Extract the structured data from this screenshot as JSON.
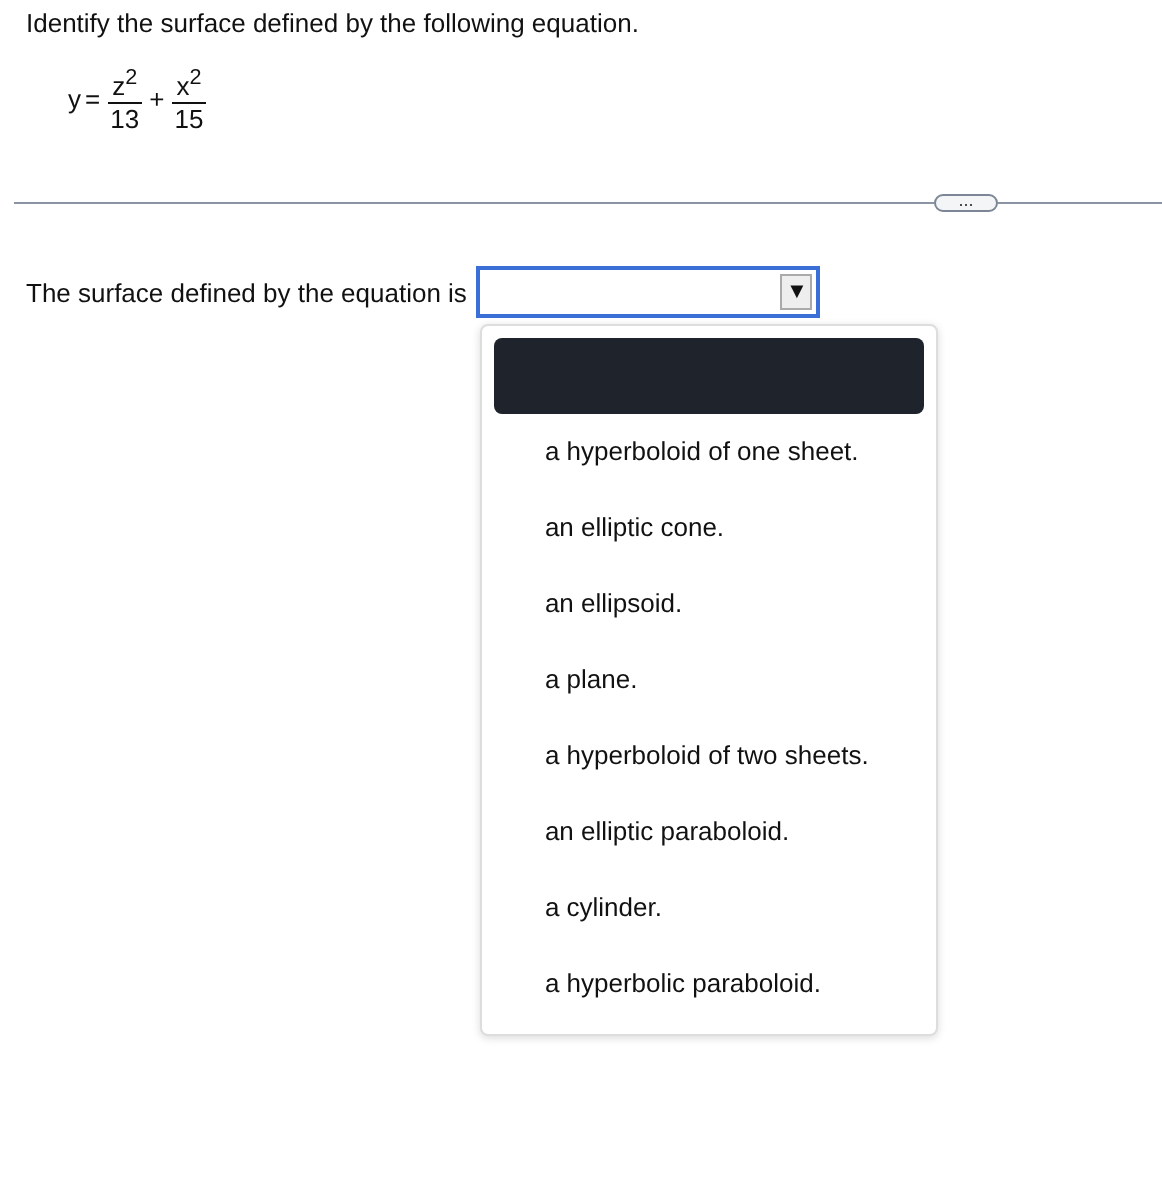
{
  "question": "Identify the surface defined by the following equation.",
  "equation": {
    "lhs": "y",
    "equals": "=",
    "terms": [
      {
        "numerator": "z$^{2}$",
        "denominator": "13"
      },
      {
        "operator": "+",
        "numerator": "x$^{2}$",
        "denominator": "15"
      }
    ]
  },
  "divider": {
    "button": "..."
  },
  "answer": {
    "prompt": "The surface defined by the equation is",
    "dropdown": {
      "arrow": "▼",
      "expanded": true,
      "options": [
        {
          "kind": "blank",
          "selected": true
        },
        {
          "kind": "text",
          "label": "a hyperboloid of one sheet.",
          "selected": false
        },
        {
          "kind": "text",
          "label": "an elliptic cone.",
          "selected": false
        },
        {
          "kind": "text",
          "label": "an ellipsoid.",
          "selected": false
        },
        {
          "kind": "text",
          "label": "a plane.",
          "selected": false
        },
        {
          "kind": "text",
          "label": "a hyperboloid of two sheets.",
          "selected": false
        },
        {
          "kind": "text",
          "label": "an elliptic paraboloid.",
          "selected": false
        },
        {
          "kind": "text",
          "label": "a cylinder.",
          "selected": false
        },
        {
          "kind": "text",
          "label": "a hyperbolic paraboloid.",
          "selected": false
        }
      ]
    }
  }
}
